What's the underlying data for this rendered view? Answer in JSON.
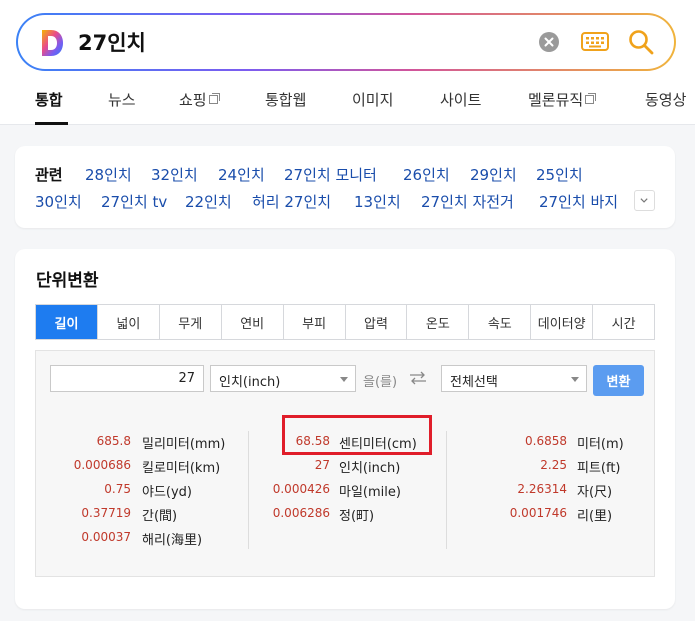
{
  "search": {
    "query": "27인치",
    "logo_letter": "D"
  },
  "tabs": [
    {
      "label": "통합",
      "active": true,
      "external": false
    },
    {
      "label": "뉴스",
      "active": false,
      "external": false
    },
    {
      "label": "쇼핑",
      "active": false,
      "external": true
    },
    {
      "label": "통합웹",
      "active": false,
      "external": false
    },
    {
      "label": "이미지",
      "active": false,
      "external": false
    },
    {
      "label": "사이트",
      "active": false,
      "external": false
    },
    {
      "label": "멜론뮤직",
      "active": false,
      "external": true
    },
    {
      "label": "동영상",
      "active": false,
      "external": false
    }
  ],
  "related": {
    "label": "관련",
    "links_row1": [
      "28인치",
      "32인치",
      "24인치",
      "27인치 모니터",
      "26인치",
      "29인치",
      "25인치"
    ],
    "links_row2": [
      "30인치",
      "27인치 tv",
      "22인치",
      "허리 27인치",
      "13인치",
      "27인치 자전거",
      "27인치 바지"
    ]
  },
  "converter": {
    "title": "단위변환",
    "unit_tabs": [
      "길이",
      "넓이",
      "무게",
      "연비",
      "부피",
      "압력",
      "온도",
      "속도",
      "데이터양",
      "시간"
    ],
    "active_tab": "길이",
    "input_value": "27",
    "from_unit": "인치(inch)",
    "particle": "을(를)",
    "to_unit": "전체선택",
    "convert_label": "변환",
    "results_col1": [
      {
        "value": "685.8",
        "unit": "밀리미터(mm)"
      },
      {
        "value": "0.000686",
        "unit": "킬로미터(km)"
      },
      {
        "value": "0.75",
        "unit": "야드(yd)"
      },
      {
        "value": "0.37719",
        "unit": "간(間)"
      },
      {
        "value": "0.00037",
        "unit": "해리(海里)"
      }
    ],
    "results_col2": [
      {
        "value": "68.58",
        "unit": "센티미터(cm)"
      },
      {
        "value": "27",
        "unit": "인치(inch)"
      },
      {
        "value": "0.000426",
        "unit": "마일(mile)"
      },
      {
        "value": "0.006286",
        "unit": "정(町)"
      }
    ],
    "results_col3": [
      {
        "value": "0.6858",
        "unit": "미터(m)"
      },
      {
        "value": "2.25",
        "unit": "피트(ft)"
      },
      {
        "value": "2.26314",
        "unit": "자(尺)"
      },
      {
        "value": "0.001746",
        "unit": "리(里)"
      }
    ]
  },
  "colors": {
    "accent": "#1e7cf0",
    "link": "#1a4dab",
    "value": "#c0392b",
    "highlight": "#e01e2a"
  },
  "icons": {
    "clear": "clear-icon",
    "keyboard": "keyboard-icon",
    "search": "search-icon",
    "swap": "swap-icon",
    "chevron": "chevron-down-icon"
  }
}
